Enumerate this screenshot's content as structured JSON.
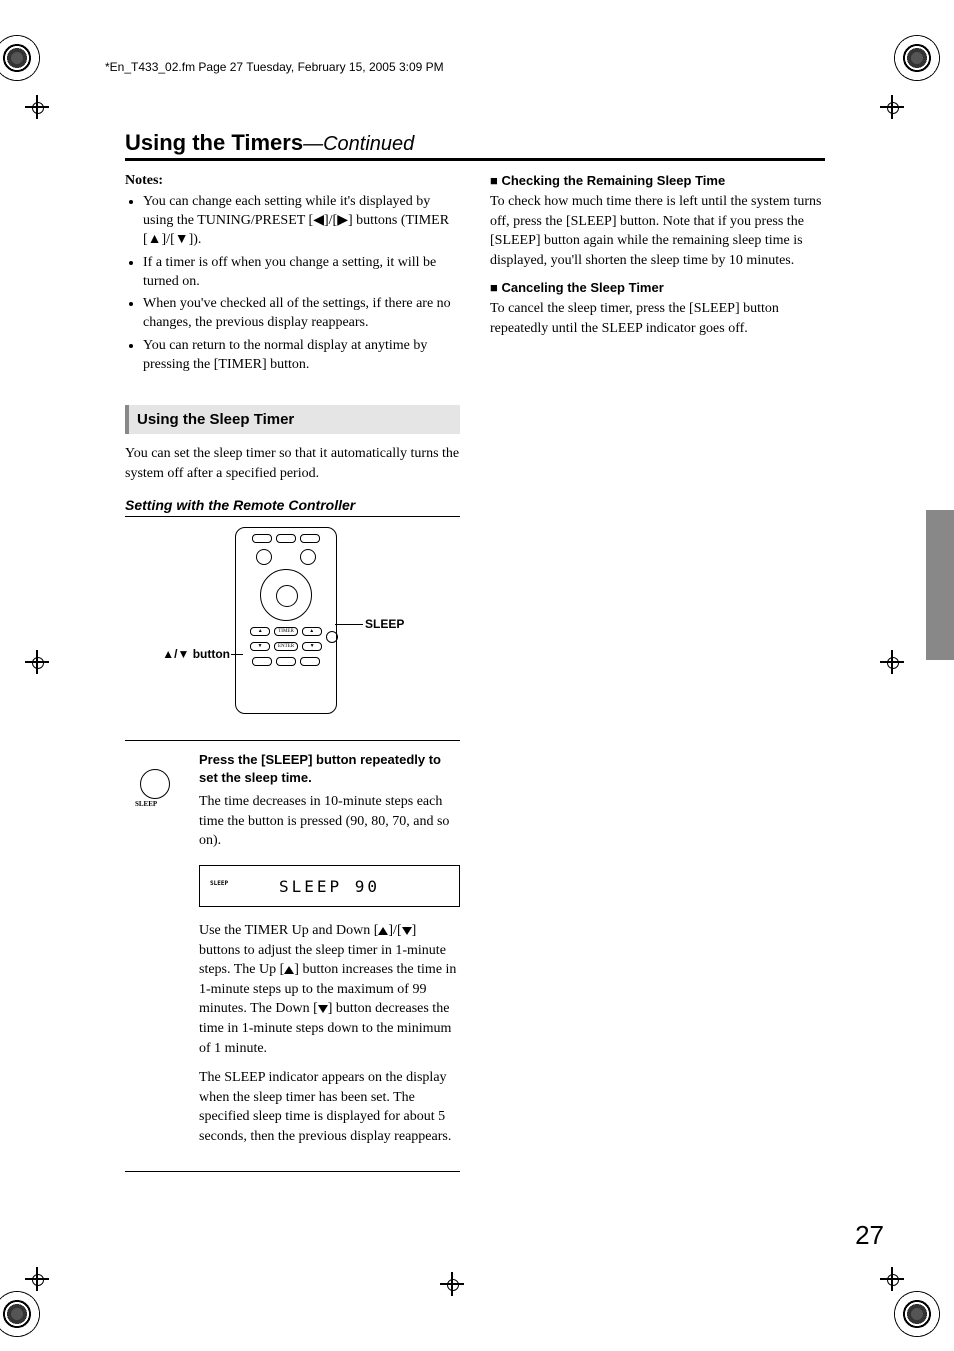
{
  "header_crop": "*En_T433_02.fm  Page 27  Tuesday, February 15, 2005  3:09 PM",
  "page_number": "27",
  "section": {
    "title": "Using the Timers",
    "continued": "—Continued"
  },
  "left": {
    "notes_label": "Notes:",
    "notes": [
      "You can change each setting while it's displayed by using the TUNING/PRESET [◀]/[▶] buttons (TIMER [▲]/[▼]).",
      "If a timer is off when you change a setting, it will be turned on.",
      "When you've checked all of the settings, if there are no changes, the previous display reappears.",
      "You can return to the normal display at anytime by pressing the [TIMER] button."
    ],
    "sleep_heading": "Using the Sleep Timer",
    "sleep_intro": "You can set the sleep timer so that it automatically turns the system off after a specified period.",
    "sub3": "Setting with the Remote Controller",
    "callouts": {
      "sleep": "SLEEP",
      "updown": "▲/▼ button"
    },
    "step": {
      "icon_label": "SLEEP",
      "instr": "Press the [SLEEP] button repeatedly to set the sleep time.",
      "p1": "The time decreases in 10-minute steps each time the button is pressed (90, 80, 70, and so on).",
      "display_small": "SLEEP",
      "display_main": "SLEEP  90",
      "p2a": "Use the TIMER Up and Down [",
      "p2b": "]/[",
      "p2c": "] buttons to adjust the sleep timer in 1-minute steps. The Up [",
      "p2d": "] button increases the time in 1-minute steps up to the maximum of 99 minutes. The Down [",
      "p2e": "] button decreases the time in 1-minute steps down to the minimum of 1 minute.",
      "p3": "The SLEEP indicator appears on the display when the sleep timer has been set. The specified sleep time is displayed for about 5 seconds, then the previous display reappears."
    }
  },
  "right": {
    "h1": "Checking the Remaining Sleep Time",
    "p1": "To check how much time there is left until the system turns off, press the [SLEEP] button. Note that if you press the [SLEEP] button again while the remaining sleep time is displayed, you'll shorten the sleep time by 10 minutes.",
    "h2": "Canceling the Sleep Timer",
    "p2": "To cancel the sleep timer, press the [SLEEP] button repeatedly until the SLEEP indicator goes off."
  }
}
